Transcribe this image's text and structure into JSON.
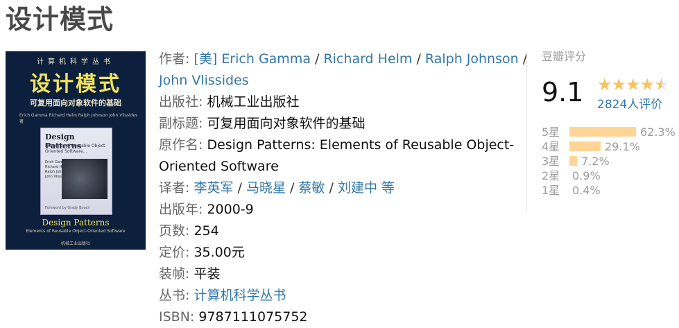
{
  "book": {
    "title": "设计模式"
  },
  "cover": {
    "series": "计算机科学丛书",
    "title_cn": "设计模式",
    "subtitle_cn": "可复用面向对象软件的基础",
    "authors_small": "Erich Gamma  Richard Helm  Ralph Johnson  John Vlissides  著",
    "inner_title": "Design Patterns",
    "inner_subtitle": "Elements of Reusable Object-Oriented Software...",
    "inner_authors": "Erich Gamma\nRichard Helm\nRalph Johnson\nJohn Vlissides",
    "inner_foot": "Foreword by Grady Booch",
    "bottom_title": "Design Patterns",
    "bottom_subtitle": "Elements of Reusable Object-Oriented Software",
    "publisher_small": "机械工业出版社"
  },
  "info": {
    "author_label": "作者:",
    "authors": [
      "[美] Erich Gamma",
      "Richard Helm",
      "Ralph Johnson",
      "John Vlissides"
    ],
    "separator": "/",
    "publisher_label": "出版社:",
    "publisher": "机械工业出版社",
    "subtitle_label": "副标题:",
    "subtitle": "可复用面向对象软件的基础",
    "original_title_label": "原作名:",
    "original_title_line1": "Design Patterns: Elements of Reusable Object-",
    "original_title_line2": "Oriented Software",
    "translator_label": "译者:",
    "translators": [
      "李英军",
      "马晓星",
      "蔡敏",
      "刘建中 等"
    ],
    "pub_year_label": "出版年:",
    "pub_year": "2000-9",
    "pages_label": "页数:",
    "pages": "254",
    "price_label": "定价:",
    "price": "35.00元",
    "binding_label": "装帧:",
    "binding": "平装",
    "series_label": "丛书:",
    "series": "计算机科学丛书",
    "isbn_label": "ISBN:",
    "isbn": "9787111075752"
  },
  "rating": {
    "label": "豆瓣评分",
    "score": "9.1",
    "stars": 4.5,
    "votes": "2824人评价",
    "distribution": [
      {
        "label": "5星",
        "percent": "62.3%",
        "value": 62.3
      },
      {
        "label": "4星",
        "percent": "29.1%",
        "value": 29.1
      },
      {
        "label": "3星",
        "percent": "7.2%",
        "value": 7.2
      },
      {
        "label": "2星",
        "percent": "0.9%",
        "value": 0.9
      },
      {
        "label": "1星",
        "percent": "0.4%",
        "value": 0.4
      }
    ],
    "colors": {
      "star": "#f7c35c",
      "bar": "#ffd596",
      "link": "#3377aa"
    }
  }
}
